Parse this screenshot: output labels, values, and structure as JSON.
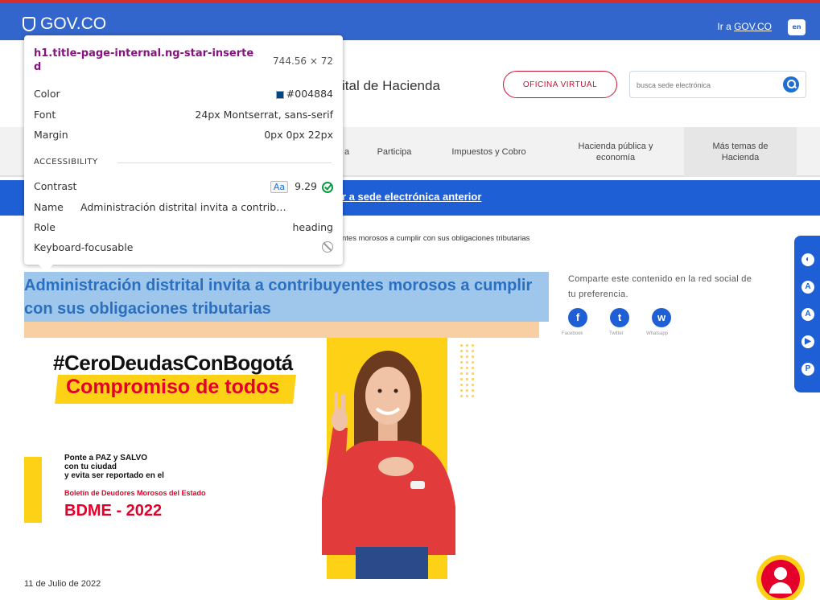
{
  "gov_bar": {
    "logo_text": "GOV.CO",
    "link_prefix": "Ir a ",
    "link_text": "GOV.CO",
    "lang_label": "en"
  },
  "header": {
    "site_title_partial": "ital de Hacienda",
    "office_button": "OFICINA VIRTUAL",
    "search_placeholder": "busca sede electrónica"
  },
  "nav": {
    "items": [
      {
        "label": "a"
      },
      {
        "label": "Participa"
      },
      {
        "label": "Impuestos y Cobro"
      },
      {
        "label": "Hacienda pública y economía"
      },
      {
        "label": "Más temas de Hacienda"
      }
    ]
  },
  "banner": {
    "link_partial": "r a sede electrónica anterior"
  },
  "breadcrumb": "ntes morosos a cumplir con sus obligaciones tributarias",
  "page": {
    "title": "Administración distrital invita a contribuyentes morosos a cumplir con sus obligaciones tributarias",
    "date": "11 de Julio de 2022"
  },
  "share": {
    "text": "Comparte este contenido en la red social de tu preferencia.",
    "items": [
      {
        "icon": "facebook-icon",
        "glyph": "f",
        "label": "Facebook"
      },
      {
        "icon": "twitter-icon",
        "glyph": "t",
        "label": "Twitter"
      },
      {
        "icon": "whatsapp-icon",
        "glyph": "w",
        "label": "Whatsapp"
      }
    ]
  },
  "campaign": {
    "hashtag": "#CeroDeudasConBogotá",
    "tagline": "Compromiso de todos",
    "paz_lines": [
      "Ponte a PAZ y SALVO",
      "con tu ciudad",
      "y evita ser reportado en el"
    ],
    "boletin": "Boletín de Deudores Morosos del Estado",
    "bdme": "BDME - 2022",
    "colors": {
      "yellow": "#fcd116",
      "red": "#e4002b"
    }
  },
  "accessibility_toolbar": {
    "buttons": [
      "contrast-icon",
      "decrease-text-icon",
      "increase-text-icon",
      "sign-language-icon",
      "relevo-icon"
    ],
    "labels": [
      "◐",
      "A",
      "A",
      "▶",
      "P"
    ]
  },
  "devtools": {
    "selector": "h1.title-page-internal.ng-star-inserted",
    "dimensions": "744.56 × 72",
    "color_label": "Color",
    "color_value": "#004884",
    "font_label": "Font",
    "font_value": "24px Montserrat, sans-serif",
    "margin_label": "Margin",
    "margin_value": "0px 0px 22px",
    "section": "ACCESSIBILITY",
    "contrast_label": "Contrast",
    "contrast_aa": "Aa",
    "contrast_value": "9.29",
    "name_label": "Name",
    "name_value": "Administración distrital invita a contrib…",
    "role_label": "Role",
    "role_value": "heading",
    "focus_label": "Keyboard-focusable"
  },
  "colors": {
    "gov_blue": "#3366cc",
    "banner_blue": "#1f5fd6",
    "title_blue": "#2c6fbf",
    "highlight": "#9ec7eb",
    "margin_overlay": "#f7cfa3"
  }
}
